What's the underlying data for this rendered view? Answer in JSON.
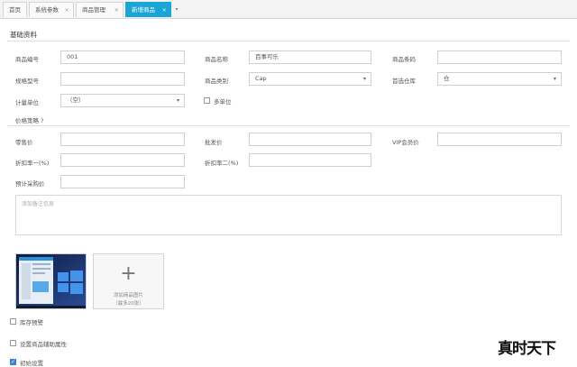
{
  "tabs": [
    {
      "label": "首页",
      "closable": false
    },
    {
      "label": "系统参数",
      "closable": true
    },
    {
      "label": "商品管理",
      "closable": true
    },
    {
      "label": "新增商品",
      "closable": true,
      "active": true
    }
  ],
  "tab_more_glyph": "▾",
  "close_glyph": "×",
  "section_basic": "基础资料",
  "fields": {
    "code": {
      "label": "商品编号",
      "value": "001"
    },
    "name": {
      "label": "商品名称",
      "value": "百事可乐"
    },
    "barcode": {
      "label": "商品条码",
      "value": ""
    },
    "model": {
      "label": "规格型号",
      "value": ""
    },
    "category": {
      "label": "商品类别",
      "value": "Cap"
    },
    "warehouse": {
      "label": "首选仓库",
      "value": "仓"
    },
    "unit": {
      "label": "计量单位",
      "value": "（空）"
    },
    "multi_unit": {
      "label": "多单位",
      "checked": false
    }
  },
  "price_strategy_title": "价格策略 ?",
  "prices": {
    "retail": {
      "label": "零售价",
      "value": ""
    },
    "wholesale": {
      "label": "批发价",
      "value": ""
    },
    "vip": {
      "label": "VIP会员价",
      "value": ""
    },
    "discount1": {
      "label": "折扣率一(%)",
      "value": ""
    },
    "discount2": {
      "label": "折扣率二(%)",
      "value": ""
    },
    "purchase": {
      "label": "预计采购价",
      "value": ""
    }
  },
  "remark_placeholder": "添加备注信息",
  "upload": {
    "plus": "+",
    "line1": "添加商品图片",
    "line2": "（最多20张）"
  },
  "options": [
    {
      "label": "库存预警",
      "checked": false
    },
    {
      "label": "设置商品辅助属性",
      "checked": false
    },
    {
      "label": "初始设置",
      "checked": true
    }
  ],
  "watermark": "真时天下",
  "colors": {
    "accent": "#19a5d6",
    "check": "#3b82d6"
  }
}
